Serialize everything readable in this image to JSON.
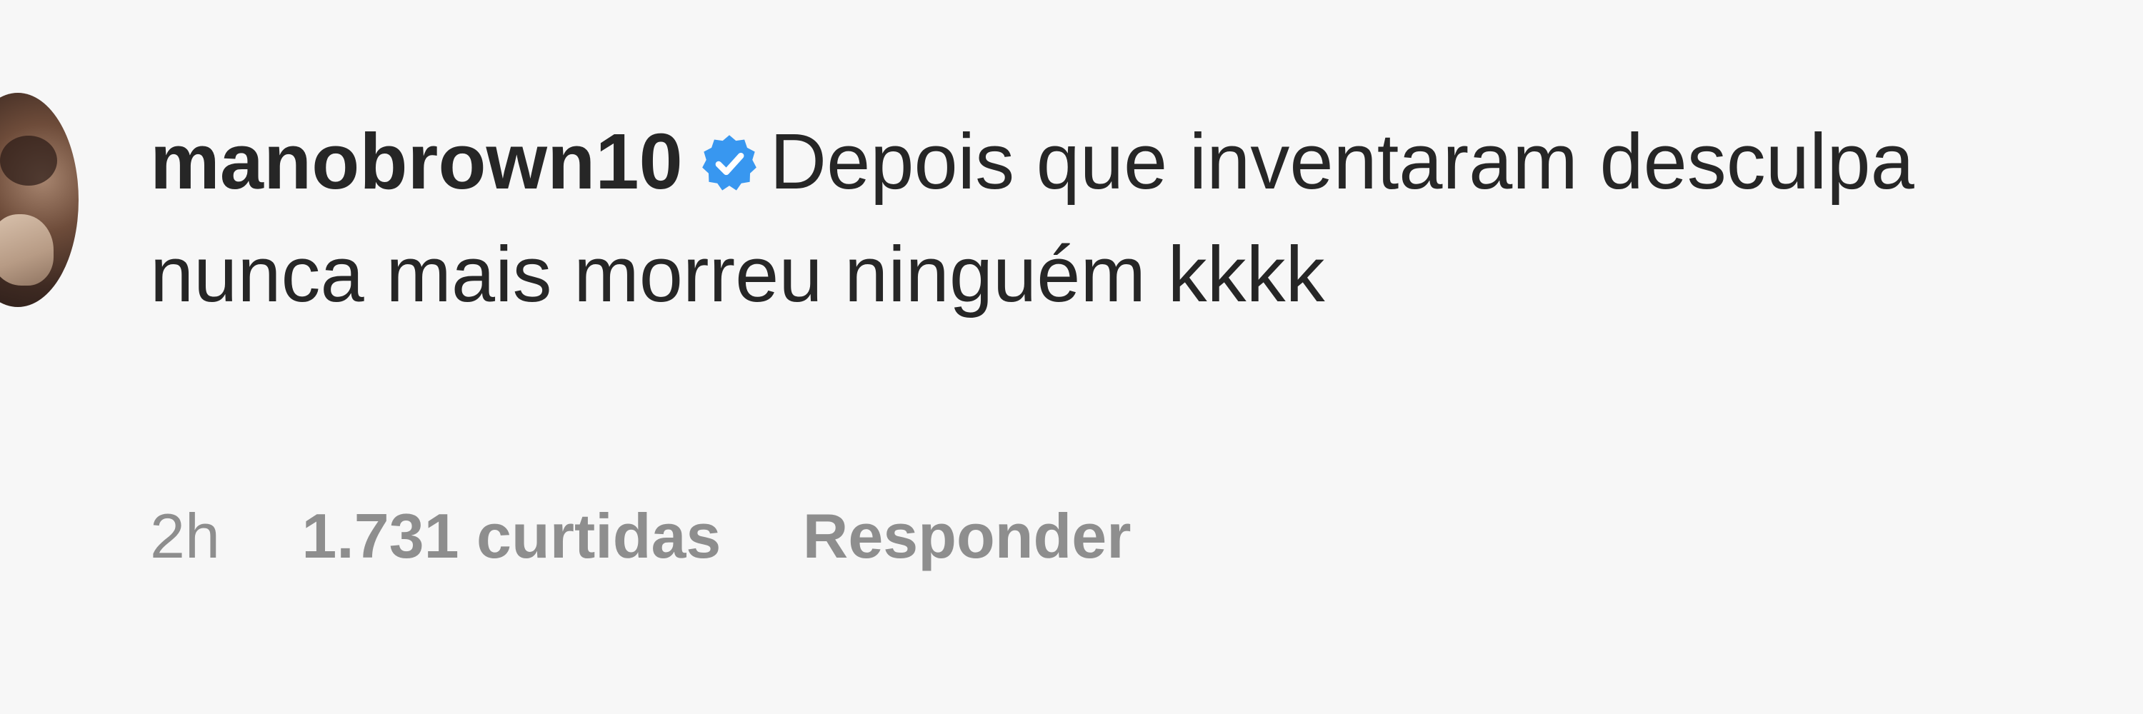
{
  "comment": {
    "username": "manobrown10",
    "verified_icon": "verified-badge-icon",
    "verified_color": "#3897f0",
    "text": "Depois que inventaram desculpa nunca mais morreu ninguém kkkk",
    "time": "2h",
    "likes": "1.731 curtidas",
    "reply_label": "Responder"
  }
}
